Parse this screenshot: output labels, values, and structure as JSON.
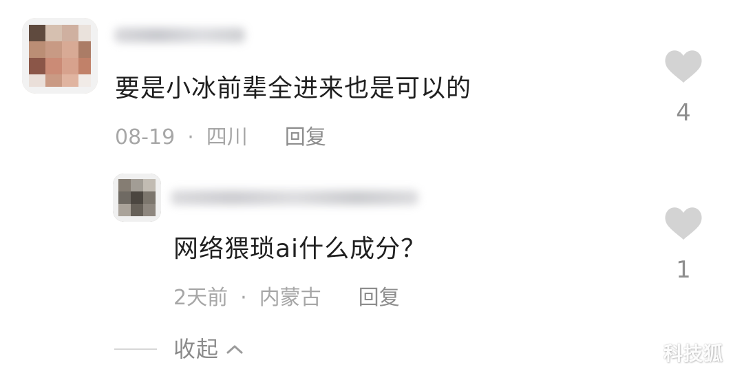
{
  "comments": {
    "main": {
      "text": "要是小冰前辈全进来也是可以的",
      "date": "08-19",
      "location": "四川",
      "reply_label": "回复",
      "like_count": "4",
      "like_icon": "heart-icon",
      "avatar_name": "avatar"
    },
    "reply": {
      "text": "网络猥琐ai什么成分？",
      "date": "2天前",
      "location": "内蒙古",
      "reply_label": "回复",
      "like_count": "1",
      "like_icon": "heart-icon",
      "avatar_name": "avatar"
    }
  },
  "collapse": {
    "label": "收起",
    "icon": "chevron-up-icon"
  },
  "watermark": {
    "text": "科技狐"
  },
  "colors": {
    "text_primary": "#1f1f1f",
    "text_secondary": "#a3a3a3",
    "heart": "#d3d3d3"
  }
}
